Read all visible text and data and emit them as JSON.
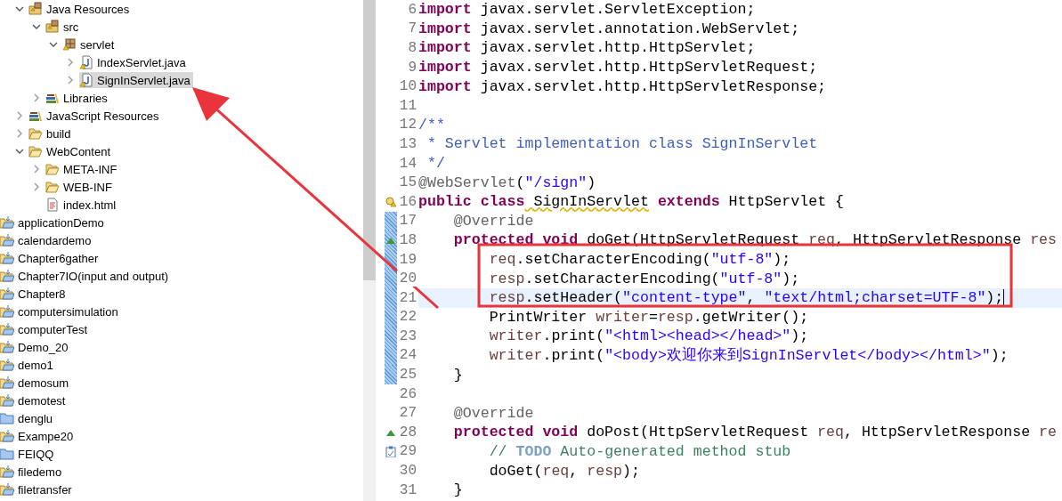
{
  "explorer": {
    "tree": [
      {
        "label": "Java Resources",
        "kind": "java-resources",
        "expanded": true,
        "selected": false,
        "children": [
          {
            "label": "src",
            "kind": "package-root",
            "expanded": true,
            "selected": false,
            "children": [
              {
                "label": "servlet",
                "kind": "package",
                "expanded": true,
                "selected": false,
                "children": [
                  {
                    "label": "IndexServlet.java",
                    "kind": "java-file",
                    "expanded": false,
                    "selected": false
                  },
                  {
                    "label": "SignInServlet.java",
                    "kind": "java-file",
                    "expanded": false,
                    "selected": true
                  }
                ]
              }
            ]
          },
          {
            "label": "Libraries",
            "kind": "library",
            "expanded": false,
            "selected": false
          }
        ]
      },
      {
        "label": "JavaScript Resources",
        "kind": "library",
        "expanded": false,
        "selected": false
      },
      {
        "label": "build",
        "kind": "folder",
        "expanded": false,
        "selected": false
      },
      {
        "label": "WebContent",
        "kind": "folder",
        "expanded": true,
        "selected": false,
        "children": [
          {
            "label": "META-INF",
            "kind": "folder",
            "expanded": false,
            "selected": false
          },
          {
            "label": "WEB-INF",
            "kind": "folder",
            "expanded": false,
            "selected": false
          },
          {
            "label": "index.html",
            "kind": "html-file",
            "selected": false
          }
        ]
      }
    ],
    "projects": [
      {
        "label": "applicationDemo",
        "kind": "project"
      },
      {
        "label": "calendardemo",
        "kind": "project"
      },
      {
        "label": "Chapter6gather",
        "kind": "project"
      },
      {
        "label": "Chapter7IO(input and output)",
        "kind": "project"
      },
      {
        "label": "Chapter8",
        "kind": "project"
      },
      {
        "label": "computersimulation",
        "kind": "project"
      },
      {
        "label": "computerTest",
        "kind": "project"
      },
      {
        "label": "Demo_20",
        "kind": "project"
      },
      {
        "label": "demo1",
        "kind": "project"
      },
      {
        "label": "demosum",
        "kind": "project"
      },
      {
        "label": "demotest",
        "kind": "project"
      },
      {
        "label": "denglu",
        "kind": "closed-project"
      },
      {
        "label": "Exampe20",
        "kind": "project"
      },
      {
        "label": "FEIQQ",
        "kind": "closed-project"
      },
      {
        "label": "filedemo",
        "kind": "project"
      },
      {
        "label": "filetransfer",
        "kind": "project"
      }
    ]
  },
  "editor": {
    "lines": [
      {
        "number": "6",
        "changed": false,
        "current": false,
        "tokens": [
          {
            "kind": "keyword",
            "text": "import"
          },
          {
            "kind": "plain",
            "text": " javax.servlet.ServletException;"
          }
        ]
      },
      {
        "number": "7",
        "changed": false,
        "current": false,
        "tokens": [
          {
            "kind": "keyword",
            "text": "import"
          },
          {
            "kind": "plain",
            "text": " javax.servlet.annotation.WebServlet;"
          }
        ]
      },
      {
        "number": "8",
        "changed": false,
        "current": false,
        "tokens": [
          {
            "kind": "keyword",
            "text": "import"
          },
          {
            "kind": "plain",
            "text": " javax.servlet.http.HttpServlet;"
          }
        ]
      },
      {
        "number": "9",
        "changed": false,
        "current": false,
        "tokens": [
          {
            "kind": "keyword",
            "text": "import"
          },
          {
            "kind": "plain",
            "text": " javax.servlet.http.HttpServletRequest;"
          }
        ]
      },
      {
        "number": "10",
        "changed": false,
        "current": false,
        "tokens": [
          {
            "kind": "keyword",
            "text": "import"
          },
          {
            "kind": "plain",
            "text": " javax.servlet.http.HttpServletResponse;"
          }
        ]
      },
      {
        "number": "11",
        "changed": false,
        "current": false
      },
      {
        "number": "12",
        "changed": false,
        "current": false,
        "tokens": [
          {
            "kind": "javadoc",
            "text": "/**"
          }
        ]
      },
      {
        "number": "13",
        "changed": false,
        "current": false,
        "tokens": [
          {
            "kind": "javadoc",
            "text": " * Servlet implementation class SignInServlet"
          }
        ]
      },
      {
        "number": "14",
        "changed": false,
        "current": false,
        "tokens": [
          {
            "kind": "javadoc",
            "text": " */"
          }
        ]
      },
      {
        "number": "15",
        "changed": false,
        "current": false,
        "tokens": [
          {
            "kind": "annotation",
            "text": "@WebServlet"
          },
          {
            "kind": "plain",
            "text": "("
          },
          {
            "kind": "string",
            "text": "\"/sign\""
          },
          {
            "kind": "plain",
            "text": ")"
          }
        ]
      },
      {
        "number": "16",
        "marker": {
          "kind": "warning"
        },
        "changed": false,
        "current": false,
        "tokens": [
          {
            "kind": "keyword",
            "text": "public class"
          },
          {
            "kind": "warning",
            "text": " SignInServlet"
          },
          {
            "kind": "keyword",
            "text": " extends"
          },
          {
            "kind": "plain",
            "text": " HttpServlet {"
          }
        ]
      },
      {
        "number": "17",
        "changed": true,
        "current": false,
        "tokens": [
          {
            "kind": "annotation",
            "text": "    @Override"
          }
        ]
      },
      {
        "number": "18",
        "marker": {
          "kind": "override"
        },
        "changed": true,
        "current": false,
        "tokens": [
          {
            "kind": "keyword",
            "text": "    protected void"
          },
          {
            "kind": "plain",
            "text": " doGet(HttpServletRequest"
          },
          {
            "kind": "local",
            "text": " req"
          },
          {
            "kind": "plain",
            "text": ", HttpServletResponse"
          },
          {
            "kind": "local",
            "text": " res"
          }
        ]
      },
      {
        "number": "19",
        "changed": true,
        "current": false,
        "tokens": [
          {
            "kind": "local",
            "text": "        req"
          },
          {
            "kind": "plain",
            "text": ".setCharacterEncoding("
          },
          {
            "kind": "string",
            "text": "\"utf-8\""
          },
          {
            "kind": "plain",
            "text": ");"
          }
        ]
      },
      {
        "number": "20",
        "changed": true,
        "current": false,
        "tokens": [
          {
            "kind": "local",
            "text": "        resp"
          },
          {
            "kind": "plain",
            "text": ".setCharacterEncoding("
          },
          {
            "kind": "string",
            "text": "\"utf-8\""
          },
          {
            "kind": "plain",
            "text": ");"
          }
        ]
      },
      {
        "number": "21",
        "changed": true,
        "current": true,
        "tokens": [
          {
            "kind": "local",
            "text": "        resp"
          },
          {
            "kind": "plain",
            "text": ".setHeader("
          },
          {
            "kind": "string",
            "text": "\"content-type\""
          },
          {
            "kind": "plain",
            "text": ", "
          },
          {
            "kind": "string",
            "text": "\"text/html;charset=UTF-8\""
          },
          {
            "kind": "plain",
            "text": ");"
          }
        ]
      },
      {
        "number": "22",
        "changed": true,
        "current": false,
        "tokens": [
          {
            "kind": "plain",
            "text": "        PrintWriter"
          },
          {
            "kind": "local",
            "text": " writer"
          },
          {
            "kind": "plain",
            "text": "="
          },
          {
            "kind": "local",
            "text": "resp"
          },
          {
            "kind": "plain",
            "text": ".getWriter();"
          }
        ]
      },
      {
        "number": "23",
        "changed": true,
        "current": false,
        "tokens": [
          {
            "kind": "local",
            "text": "        writer"
          },
          {
            "kind": "plain",
            "text": ".print("
          },
          {
            "kind": "string",
            "text": "\"<html><head></head>\""
          },
          {
            "kind": "plain",
            "text": ");"
          }
        ]
      },
      {
        "number": "24",
        "changed": true,
        "current": false,
        "tokens": [
          {
            "kind": "local",
            "text": "        writer"
          },
          {
            "kind": "plain",
            "text": ".print("
          },
          {
            "kind": "string",
            "text": "\"<body>欢迎你来到SignInServlet</body></html>\""
          },
          {
            "kind": "plain",
            "text": ");"
          }
        ]
      },
      {
        "number": "25",
        "changed": true,
        "current": false,
        "tokens": [
          {
            "kind": "plain",
            "text": "    }"
          }
        ]
      },
      {
        "number": "26",
        "changed": false,
        "current": false
      },
      {
        "number": "27",
        "changed": false,
        "current": false,
        "tokens": [
          {
            "kind": "annotation",
            "text": "    @Override"
          }
        ]
      },
      {
        "number": "28",
        "marker": {
          "kind": "override"
        },
        "changed": false,
        "current": false,
        "tokens": [
          {
            "kind": "keyword",
            "text": "    protected void"
          },
          {
            "kind": "plain",
            "text": " doPost(HttpServletRequest"
          },
          {
            "kind": "local",
            "text": " req"
          },
          {
            "kind": "plain",
            "text": ", HttpServletResponse"
          },
          {
            "kind": "local",
            "text": " re"
          }
        ]
      },
      {
        "number": "29",
        "marker": {
          "kind": "task"
        },
        "changed": false,
        "current": false,
        "tokens": [
          {
            "kind": "comment",
            "text": "        //"
          },
          {
            "kind": "task",
            "text": " TODO"
          },
          {
            "kind": "comment",
            "text": " Auto-generated method stub"
          }
        ]
      },
      {
        "number": "30",
        "changed": false,
        "current": false,
        "tokens": [
          {
            "kind": "plain",
            "text": "        doGet("
          },
          {
            "kind": "local",
            "text": "req"
          },
          {
            "kind": "plain",
            "text": ", "
          },
          {
            "kind": "local",
            "text": "resp"
          },
          {
            "kind": "plain",
            "text": ");"
          }
        ]
      },
      {
        "number": "31",
        "changed": false,
        "current": false,
        "tokens": [
          {
            "kind": "plain",
            "text": "    }"
          }
        ]
      }
    ]
  }
}
